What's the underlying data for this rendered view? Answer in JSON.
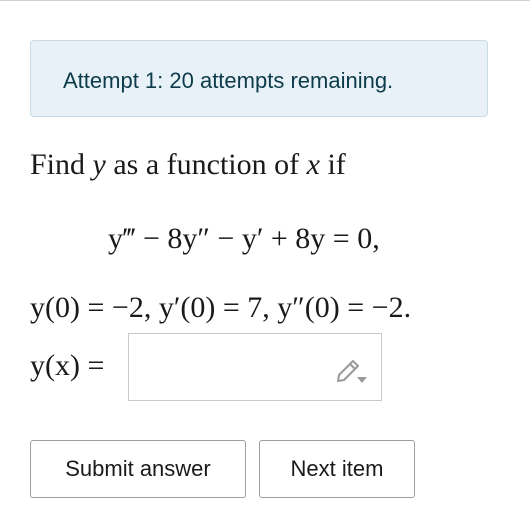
{
  "status": {
    "attempt_text": "Attempt 1: 20 attempts remaining."
  },
  "problem": {
    "prompt_find": "Find",
    "prompt_y": "y",
    "prompt_mid": "as a function of",
    "prompt_x": "x",
    "prompt_if": "if",
    "equation": "y‴ − 8y″ − y′ + 8y = 0,",
    "initial_conditions": "y(0) = −2,  y′(0) = 7,  y″(0) = −2.",
    "answer_label": "y(x) ="
  },
  "answer": {
    "value": "",
    "editor_icon": "pencil-dropdown-icon"
  },
  "buttons": {
    "submit_label": "Submit answer",
    "next_label": "Next item"
  }
}
